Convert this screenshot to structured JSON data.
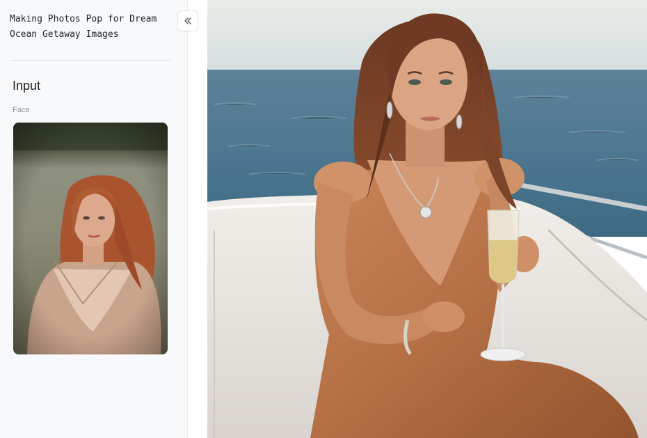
{
  "sidebar": {
    "title": "Making Photos Pop for Dream\nOcean Getaway Images",
    "collapse_icon": "double-chevron-left-icon",
    "section_title": "Input",
    "field_label": "Face"
  },
  "colors": {
    "sidebar_bg": "#f8f9fb",
    "sea": "#4d7790",
    "sky": "#dfe5e6",
    "dress": "#b9774c",
    "hair": "#7a4127"
  }
}
